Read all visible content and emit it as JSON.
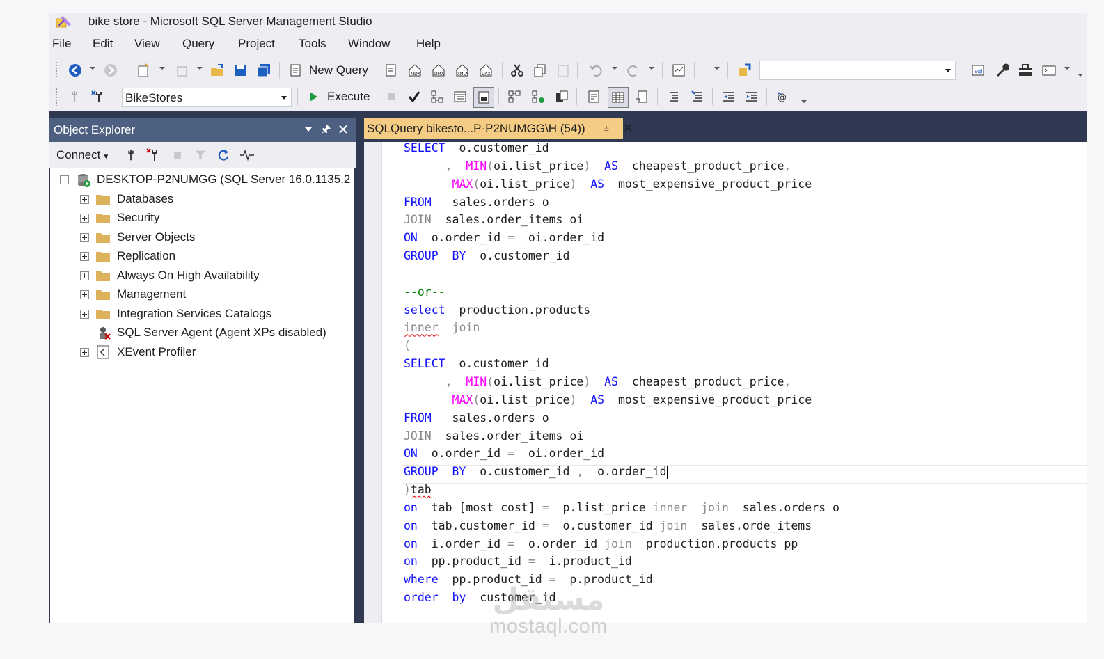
{
  "window": {
    "title": "bike store - Microsoft SQL Server Management Studio"
  },
  "menu": [
    "File",
    "Edit",
    "View",
    "Query",
    "Project",
    "Tools",
    "Window",
    "Help"
  ],
  "toolbar": {
    "new_query_label": "New Query",
    "execute_label": "Execute",
    "database_selected": "BikeStores",
    "search_value": ""
  },
  "object_explorer": {
    "title": "Object Explorer",
    "connect_label": "Connect",
    "server": "DESKTOP-P2NUMGG (SQL Server 16.0.1135.2 -",
    "nodes": [
      {
        "label": "Databases",
        "icon": "folder-icon",
        "expandable": true
      },
      {
        "label": "Security",
        "icon": "folder-icon",
        "expandable": true
      },
      {
        "label": "Server Objects",
        "icon": "folder-icon",
        "expandable": true
      },
      {
        "label": "Replication",
        "icon": "folder-icon",
        "expandable": true
      },
      {
        "label": "Always On High Availability",
        "icon": "folder-icon",
        "expandable": true
      },
      {
        "label": "Management",
        "icon": "folder-icon",
        "expandable": true
      },
      {
        "label": "Integration Services Catalogs",
        "icon": "folder-icon",
        "expandable": true
      },
      {
        "label": "SQL Server Agent (Agent XPs disabled)",
        "icon": "agent-disabled-icon",
        "expandable": false
      },
      {
        "label": "XEvent Profiler",
        "icon": "xevent-icon",
        "expandable": true
      }
    ]
  },
  "editor": {
    "tab_label": "SQLQuery bikesto...P-P2NUMGG\\H (54))",
    "code_lines": [
      [
        [
          "kw",
          "SELECT"
        ],
        [
          "",
          "  o.customer_id"
        ]
      ],
      [
        [
          "",
          "      "
        ],
        [
          "gy",
          ","
        ],
        [
          "",
          "  "
        ],
        [
          "fn",
          "MIN"
        ],
        [
          "gy",
          "("
        ],
        [
          "",
          "oi.list_price"
        ],
        [
          "gy",
          ")"
        ],
        [
          "",
          "  "
        ],
        [
          "kw",
          "AS"
        ],
        [
          "",
          "  cheapest_product_price"
        ],
        [
          "gy",
          ","
        ]
      ],
      [
        [
          "",
          "       "
        ],
        [
          "fn",
          "MAX"
        ],
        [
          "gy",
          "("
        ],
        [
          "",
          "oi.list_price"
        ],
        [
          "gy",
          ")"
        ],
        [
          "",
          "  "
        ],
        [
          "kw",
          "AS"
        ],
        [
          "",
          "  most_expensive_product_price"
        ]
      ],
      [
        [
          "kw",
          "FROM"
        ],
        [
          "",
          "   sales.orders o"
        ]
      ],
      [
        [
          "gy",
          "JOIN"
        ],
        [
          "",
          "  sales.order_items oi"
        ]
      ],
      [
        [
          "kw",
          "ON"
        ],
        [
          "",
          "  o.order_id "
        ],
        [
          "gy",
          "="
        ],
        [
          "",
          "  oi.order_id"
        ]
      ],
      [
        [
          "kw",
          "GROUP"
        ],
        [
          "",
          "  "
        ],
        [
          "kw",
          "BY"
        ],
        [
          "",
          "  o.customer_id"
        ]
      ],
      [
        [
          "",
          ""
        ]
      ],
      [
        [
          "cm",
          "--or--"
        ]
      ],
      [
        [
          "kw",
          "select"
        ],
        [
          "",
          "  production.products"
        ]
      ],
      [
        [
          "gy squig",
          "inner"
        ],
        [
          "",
          "  "
        ],
        [
          "gy",
          "join"
        ]
      ],
      [
        [
          "gy",
          "("
        ]
      ],
      [
        [
          "kw",
          "SELECT"
        ],
        [
          "",
          "  o.customer_id"
        ]
      ],
      [
        [
          "",
          "      "
        ],
        [
          "gy",
          ","
        ],
        [
          "",
          "  "
        ],
        [
          "fn",
          "MIN"
        ],
        [
          "gy",
          "("
        ],
        [
          "",
          "oi.list_price"
        ],
        [
          "gy",
          ")"
        ],
        [
          "",
          "  "
        ],
        [
          "kw",
          "AS"
        ],
        [
          "",
          "  cheapest_product_price"
        ],
        [
          "gy",
          ","
        ]
      ],
      [
        [
          "",
          "       "
        ],
        [
          "fn",
          "MAX"
        ],
        [
          "gy",
          "("
        ],
        [
          "",
          "oi.list_price"
        ],
        [
          "gy",
          ")"
        ],
        [
          "",
          "  "
        ],
        [
          "kw",
          "AS"
        ],
        [
          "",
          "  most_expensive_product_price"
        ]
      ],
      [
        [
          "kw",
          "FROM"
        ],
        [
          "",
          "   sales.orders o"
        ]
      ],
      [
        [
          "gy",
          "JOIN"
        ],
        [
          "",
          "  sales.order_items oi"
        ]
      ],
      [
        [
          "kw",
          "ON"
        ],
        [
          "",
          "  o.order_id "
        ],
        [
          "gy",
          "="
        ],
        [
          "",
          "  oi.order_id"
        ]
      ],
      [
        [
          "kw",
          "GROUP"
        ],
        [
          "",
          "  "
        ],
        [
          "kw",
          "BY"
        ],
        [
          "",
          "  o.customer_id "
        ],
        [
          "gy",
          ","
        ],
        [
          "",
          "  o.order_id"
        ]
      ],
      [
        [
          "gy",
          ")"
        ],
        [
          "squig",
          "tab"
        ]
      ],
      [
        [
          "kw",
          "on"
        ],
        [
          "",
          "  tab [most cost] "
        ],
        [
          "gy",
          "="
        ],
        [
          "",
          "  p.list_price "
        ],
        [
          "gy",
          "inner"
        ],
        [
          "",
          "  "
        ],
        [
          "gy",
          "join"
        ],
        [
          "",
          "  sales.orders o"
        ]
      ],
      [
        [
          "kw",
          "on"
        ],
        [
          "",
          "  tab.customer_id "
        ],
        [
          "gy",
          "="
        ],
        [
          "",
          "  o.customer_id "
        ],
        [
          "gy",
          "join"
        ],
        [
          "",
          "  sales.orde_items"
        ]
      ],
      [
        [
          "kw",
          "on"
        ],
        [
          "",
          "  i.order_id "
        ],
        [
          "gy",
          "="
        ],
        [
          "",
          "  o.order_id "
        ],
        [
          "gy",
          "join"
        ],
        [
          "",
          "  production.products pp"
        ]
      ],
      [
        [
          "kw",
          "on"
        ],
        [
          "",
          "  pp.product_id "
        ],
        [
          "gy",
          "="
        ],
        [
          "",
          "  i.product_id"
        ]
      ],
      [
        [
          "kw",
          "where"
        ],
        [
          "",
          "  pp.product_id "
        ],
        [
          "gy",
          "="
        ],
        [
          "",
          "  p.product_id"
        ]
      ],
      [
        [
          "kw",
          "order"
        ],
        [
          "",
          "  "
        ],
        [
          "kw",
          "by"
        ],
        [
          "",
          "  customer_id"
        ]
      ]
    ]
  },
  "watermark": {
    "logo_text": "مستقل",
    "url_text": "mostaql.com"
  }
}
